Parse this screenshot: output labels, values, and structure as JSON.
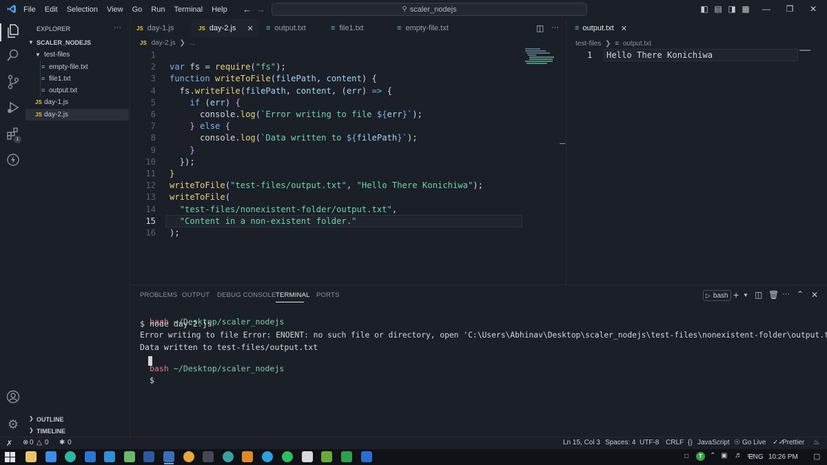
{
  "menu": [
    "File",
    "Edit",
    "Selection",
    "View",
    "Go",
    "Run",
    "Terminal",
    "Help"
  ],
  "search": {
    "label": "scaler_nodejs"
  },
  "sidebar": {
    "title": "EXPLORER",
    "root": "SCALER_NODEJS",
    "folder": "test-files",
    "folder_files": [
      "empty-file.txt",
      "file1.txt",
      "output.txt"
    ],
    "root_files": [
      "day-1.js",
      "day-2.js"
    ],
    "outline": "OUTLINE",
    "timeline": "TIMELINE"
  },
  "tabs": [
    "day-1.js",
    "day-2.js",
    "output.txt",
    "file1.txt",
    "empty-file.txt"
  ],
  "js_badge": "JS",
  "breadcrumb": {
    "file": "day-2.js",
    "ellipsis": "..."
  },
  "code": {
    "line_numbers": [
      "1",
      "2",
      "3",
      "4",
      "5",
      "6",
      "7",
      "8",
      "9",
      "10",
      "11",
      "12",
      "13",
      "14",
      "15",
      "16"
    ],
    "current_line": "15"
  },
  "right_editor": {
    "tab": "output.txt",
    "crumb_folder": "test-files",
    "crumb_file": "output.txt",
    "line_number": "1",
    "content": "Hello There Konichiwa"
  },
  "panel": {
    "tabs": [
      "PROBLEMS",
      "OUTPUT",
      "DEBUG CONSOLE",
      "TERMINAL",
      "PORTS"
    ],
    "shell": "bash",
    "lines": {
      "prompt_user": "bash",
      "prompt_path": "~/Desktop/scaler_nodejs",
      "cmd": "$ node day-2.js",
      "error": "Error writing to file Error: ENOENT: no such file or directory, open 'C:\\Users\\Abhinav\\Desktop\\scaler_nodejs\\test-files\\nonexistent-folder\\output.txt'",
      "success": "Data written to test-files/output.txt",
      "dollar": "$"
    }
  },
  "status": {
    "errors": "0",
    "warnings": "0",
    "ports": "0",
    "position": "Ln 15, Col 3",
    "spaces": "Spaces: 4",
    "encoding": "UTF-8",
    "eol": "CRLF",
    "language": "JavaScript",
    "golive": "Go Live",
    "prettier": "Prettier"
  },
  "taskbar": {
    "lang": "ENG",
    "time": "10:26 PM",
    "status_badge": "T",
    "activity_badge": "1"
  },
  "colors": {
    "accent": "#3794ff",
    "js": "#e5c547",
    "string": "#6fd3b0",
    "error_prompt": "#e07a7a",
    "path": "#7fcfa9"
  }
}
